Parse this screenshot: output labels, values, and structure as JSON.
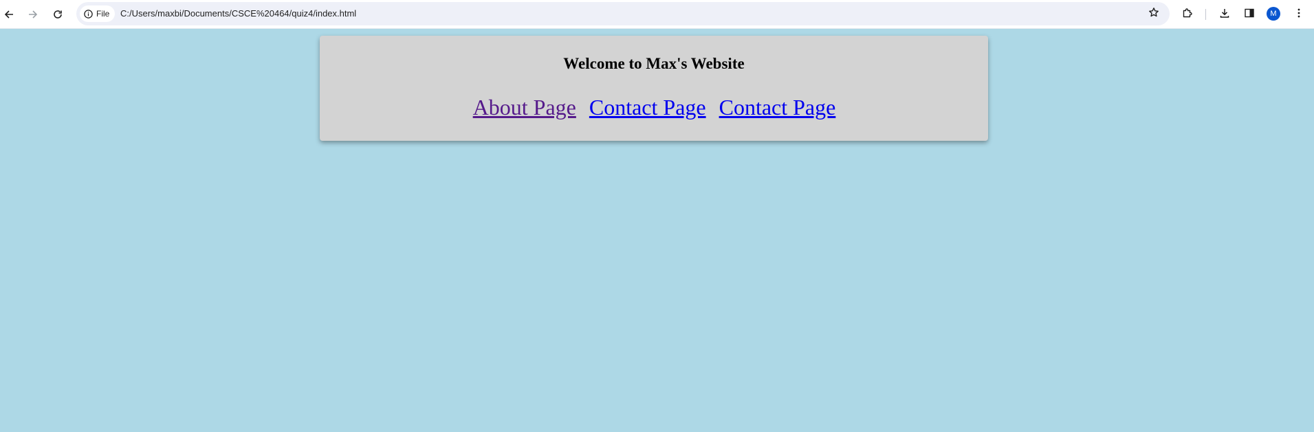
{
  "browser": {
    "site_chip_label": "File",
    "url": "C:/Users/maxbi/Documents/CSCE%20464/quiz4/index.html",
    "profile_initial": "M",
    "icons": [
      "back-arrow-icon",
      "forward-arrow-icon",
      "reload-icon",
      "info-icon",
      "star-icon",
      "extensions-icon",
      "download-icon",
      "side-panel-icon",
      "more-vert-icon"
    ]
  },
  "page": {
    "background_color": "#add8e6",
    "card_color": "#d3d3d3",
    "title": "Welcome to Max's Website",
    "links": [
      {
        "label": "About Page",
        "state": "visited",
        "color": "#551a8b"
      },
      {
        "label": "Contact Page",
        "state": "unvisited",
        "color": "#0000ee"
      },
      {
        "label": "Contact Page",
        "state": "unvisited",
        "color": "#0000ee"
      }
    ]
  }
}
